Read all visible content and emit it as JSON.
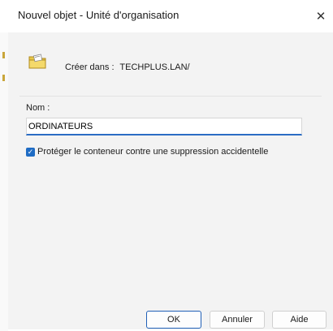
{
  "window": {
    "title": "Nouvel objet - Unité d'organisation",
    "close_glyph": "✕"
  },
  "header": {
    "icon": "ou-folder-icon",
    "create_in_label": "Créer dans :",
    "create_in_path": "TECHPLUS.LAN/"
  },
  "form": {
    "name_label": "Nom :",
    "name_value": "ORDINATEURS",
    "protect_checked": true,
    "protect_label": "Protéger le conteneur contre une suppression accidentelle"
  },
  "buttons": {
    "ok": "OK",
    "cancel": "Annuler",
    "help": "Aide"
  },
  "colors": {
    "accent": "#2b6cc4",
    "background": "#f3f3f3"
  }
}
